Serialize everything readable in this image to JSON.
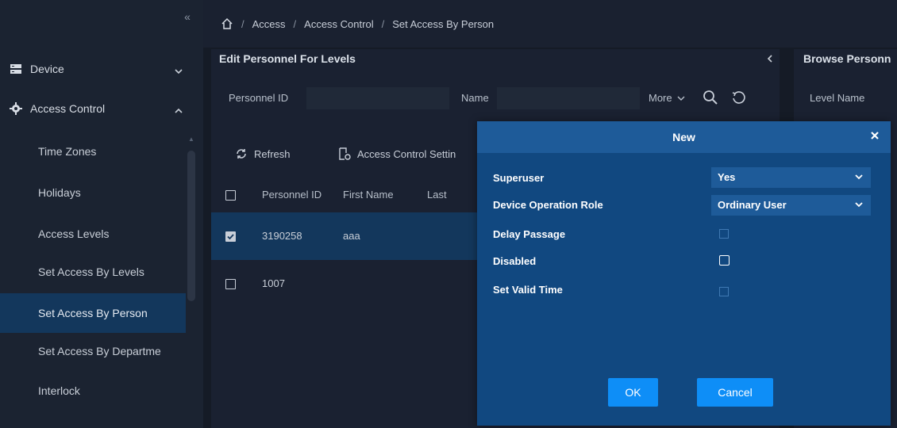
{
  "sidebar": {
    "collapse_glyph": "«",
    "groups": [
      {
        "label": "Device",
        "icon": "device-icon"
      },
      {
        "label": "Access Control",
        "icon": "gear-icon"
      }
    ],
    "items": [
      {
        "label": "Time Zones"
      },
      {
        "label": "Holidays"
      },
      {
        "label": "Access Levels"
      },
      {
        "label": "Set Access By Levels"
      },
      {
        "label": "Set Access By Person"
      },
      {
        "label": "Set Access By Departme"
      },
      {
        "label": "Interlock"
      }
    ],
    "active_item": "Set Access By Person"
  },
  "breadcrumb": {
    "items": [
      "Access",
      "Access Control",
      "Set Access By Person"
    ],
    "separator": "/"
  },
  "panel": {
    "title": "Edit Personnel For Levels",
    "search": {
      "personnel_id_label": "Personnel ID",
      "name_label": "Name",
      "more_label": "More"
    },
    "toolbar": {
      "refresh_label": "Refresh",
      "access_settings_label": "Access Control Settin"
    },
    "table": {
      "columns": [
        "Personnel ID",
        "First Name",
        "Last"
      ],
      "rows": [
        {
          "personnel_id": "3190258",
          "first_name": "aaa",
          "checked": true
        },
        {
          "personnel_id": "1007",
          "first_name": "",
          "checked": false
        }
      ]
    }
  },
  "right_panel": {
    "title": "Browse Personn",
    "label": "Level Name"
  },
  "modal": {
    "title": "New",
    "fields": {
      "superuser": {
        "label": "Superuser",
        "value": "Yes"
      },
      "device_operation_role": {
        "label": "Device Operation Role",
        "value": "Ordinary User"
      },
      "delay_passage": {
        "label": "Delay Passage"
      },
      "disabled": {
        "label": "Disabled"
      },
      "set_valid_time": {
        "label": "Set Valid Time"
      }
    },
    "ok_label": "OK",
    "cancel_label": "Cancel"
  },
  "colors": {
    "sidebar_bg": "#1b2331",
    "active_item_bg": "#13375c",
    "modal_bg": "#114880",
    "modal_header_bg": "#1e5b99",
    "button_blue": "#0e8ef7"
  }
}
